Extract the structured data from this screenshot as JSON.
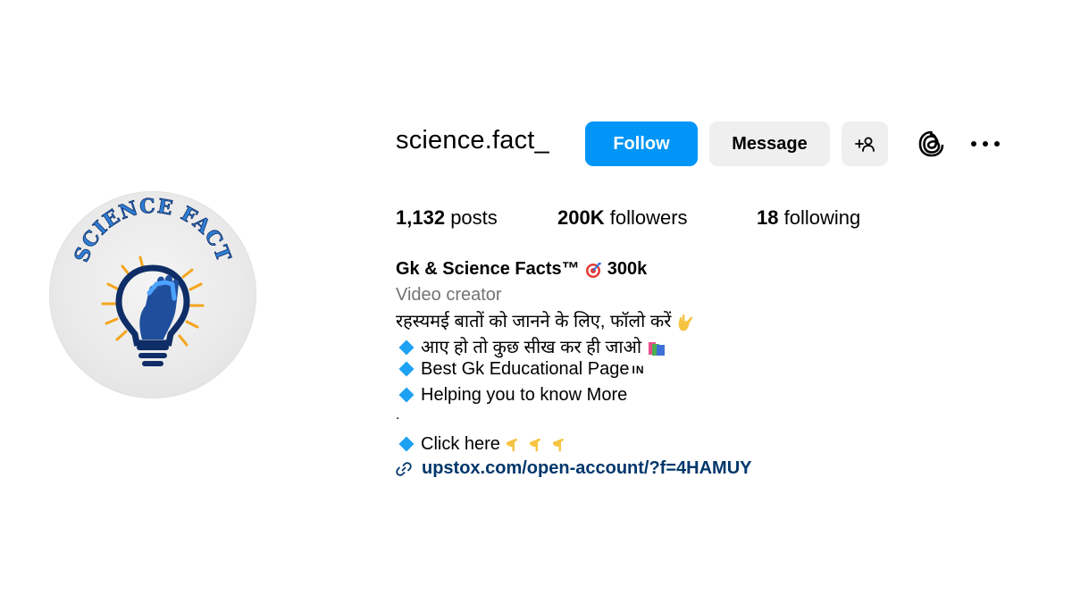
{
  "profile": {
    "username": "science.fact_",
    "full_name": "Gk & Science Facts™",
    "full_name_suffix": "300k",
    "category": "Video creator",
    "avatar_text": "SCIENCE FACT"
  },
  "actions": {
    "follow_label": "Follow",
    "message_label": "Message",
    "add_user_icon": "add-person-icon",
    "threads_icon": "threads-icon",
    "more_icon": "more-horizontal-icon"
  },
  "stats": {
    "posts_count": "1,132",
    "posts_label": "posts",
    "followers_count": "200K",
    "followers_label": "followers",
    "following_count": "18",
    "following_label": "following"
  },
  "bio": {
    "line1": "रहस्यमई बातों को जानने के लिए, फॉलो करें",
    "line2": "आए हो तो कुछ सीख कर ही जाओ",
    "line3": "Best Gk Educational Page",
    "line3_tag": "IN",
    "line4": "Helping you to know More",
    "line5": ".",
    "line6": "Click here",
    "link": "upstox.com/open-account/?f=4HAMUY"
  },
  "colors": {
    "follow_button": "#0095f6",
    "secondary_button": "#efefef",
    "link_text": "#00376b",
    "category_text": "#737373",
    "bullet_diamond": "#1da1f2"
  }
}
